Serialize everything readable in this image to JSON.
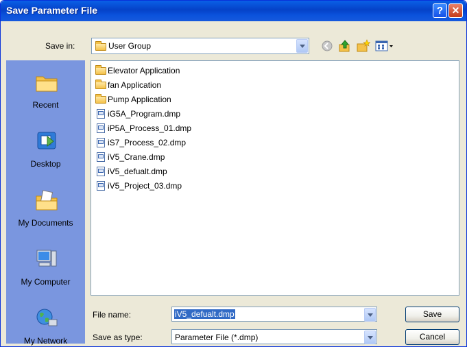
{
  "window": {
    "title": "Save Parameter File"
  },
  "toolbar": {
    "save_in_label": "Save in:",
    "save_in_value": "User Group"
  },
  "places": [
    {
      "label": "Recent",
      "icon": "recent-folder-icon"
    },
    {
      "label": "Desktop",
      "icon": "desktop-icon"
    },
    {
      "label": "My Documents",
      "icon": "my-documents-icon"
    },
    {
      "label": "My Computer",
      "icon": "my-computer-icon"
    },
    {
      "label": "My Network",
      "icon": "my-network-icon"
    }
  ],
  "files": [
    {
      "name": "Elevator Application",
      "type": "folder"
    },
    {
      "name": "fan Application",
      "type": "folder"
    },
    {
      "name": "Pump Application",
      "type": "folder"
    },
    {
      "name": "iG5A_Program.dmp",
      "type": "file"
    },
    {
      "name": "iP5A_Process_01.dmp",
      "type": "file"
    },
    {
      "name": "iS7_Process_02.dmp",
      "type": "file"
    },
    {
      "name": "iV5_Crane.dmp",
      "type": "file"
    },
    {
      "name": "iV5_defualt.dmp",
      "type": "file"
    },
    {
      "name": "iV5_Project_03.dmp",
      "type": "file"
    }
  ],
  "form": {
    "filename_label": "File name:",
    "filename_value": "iV5_defualt.dmp",
    "type_label": "Save as type:",
    "type_value": "Parameter File (*.dmp)"
  },
  "buttons": {
    "save": "Save",
    "cancel": "Cancel"
  },
  "colors": {
    "titlebar": "#0A5FE6",
    "places_bar": "#7A96DF",
    "selection": "#316AC5"
  }
}
